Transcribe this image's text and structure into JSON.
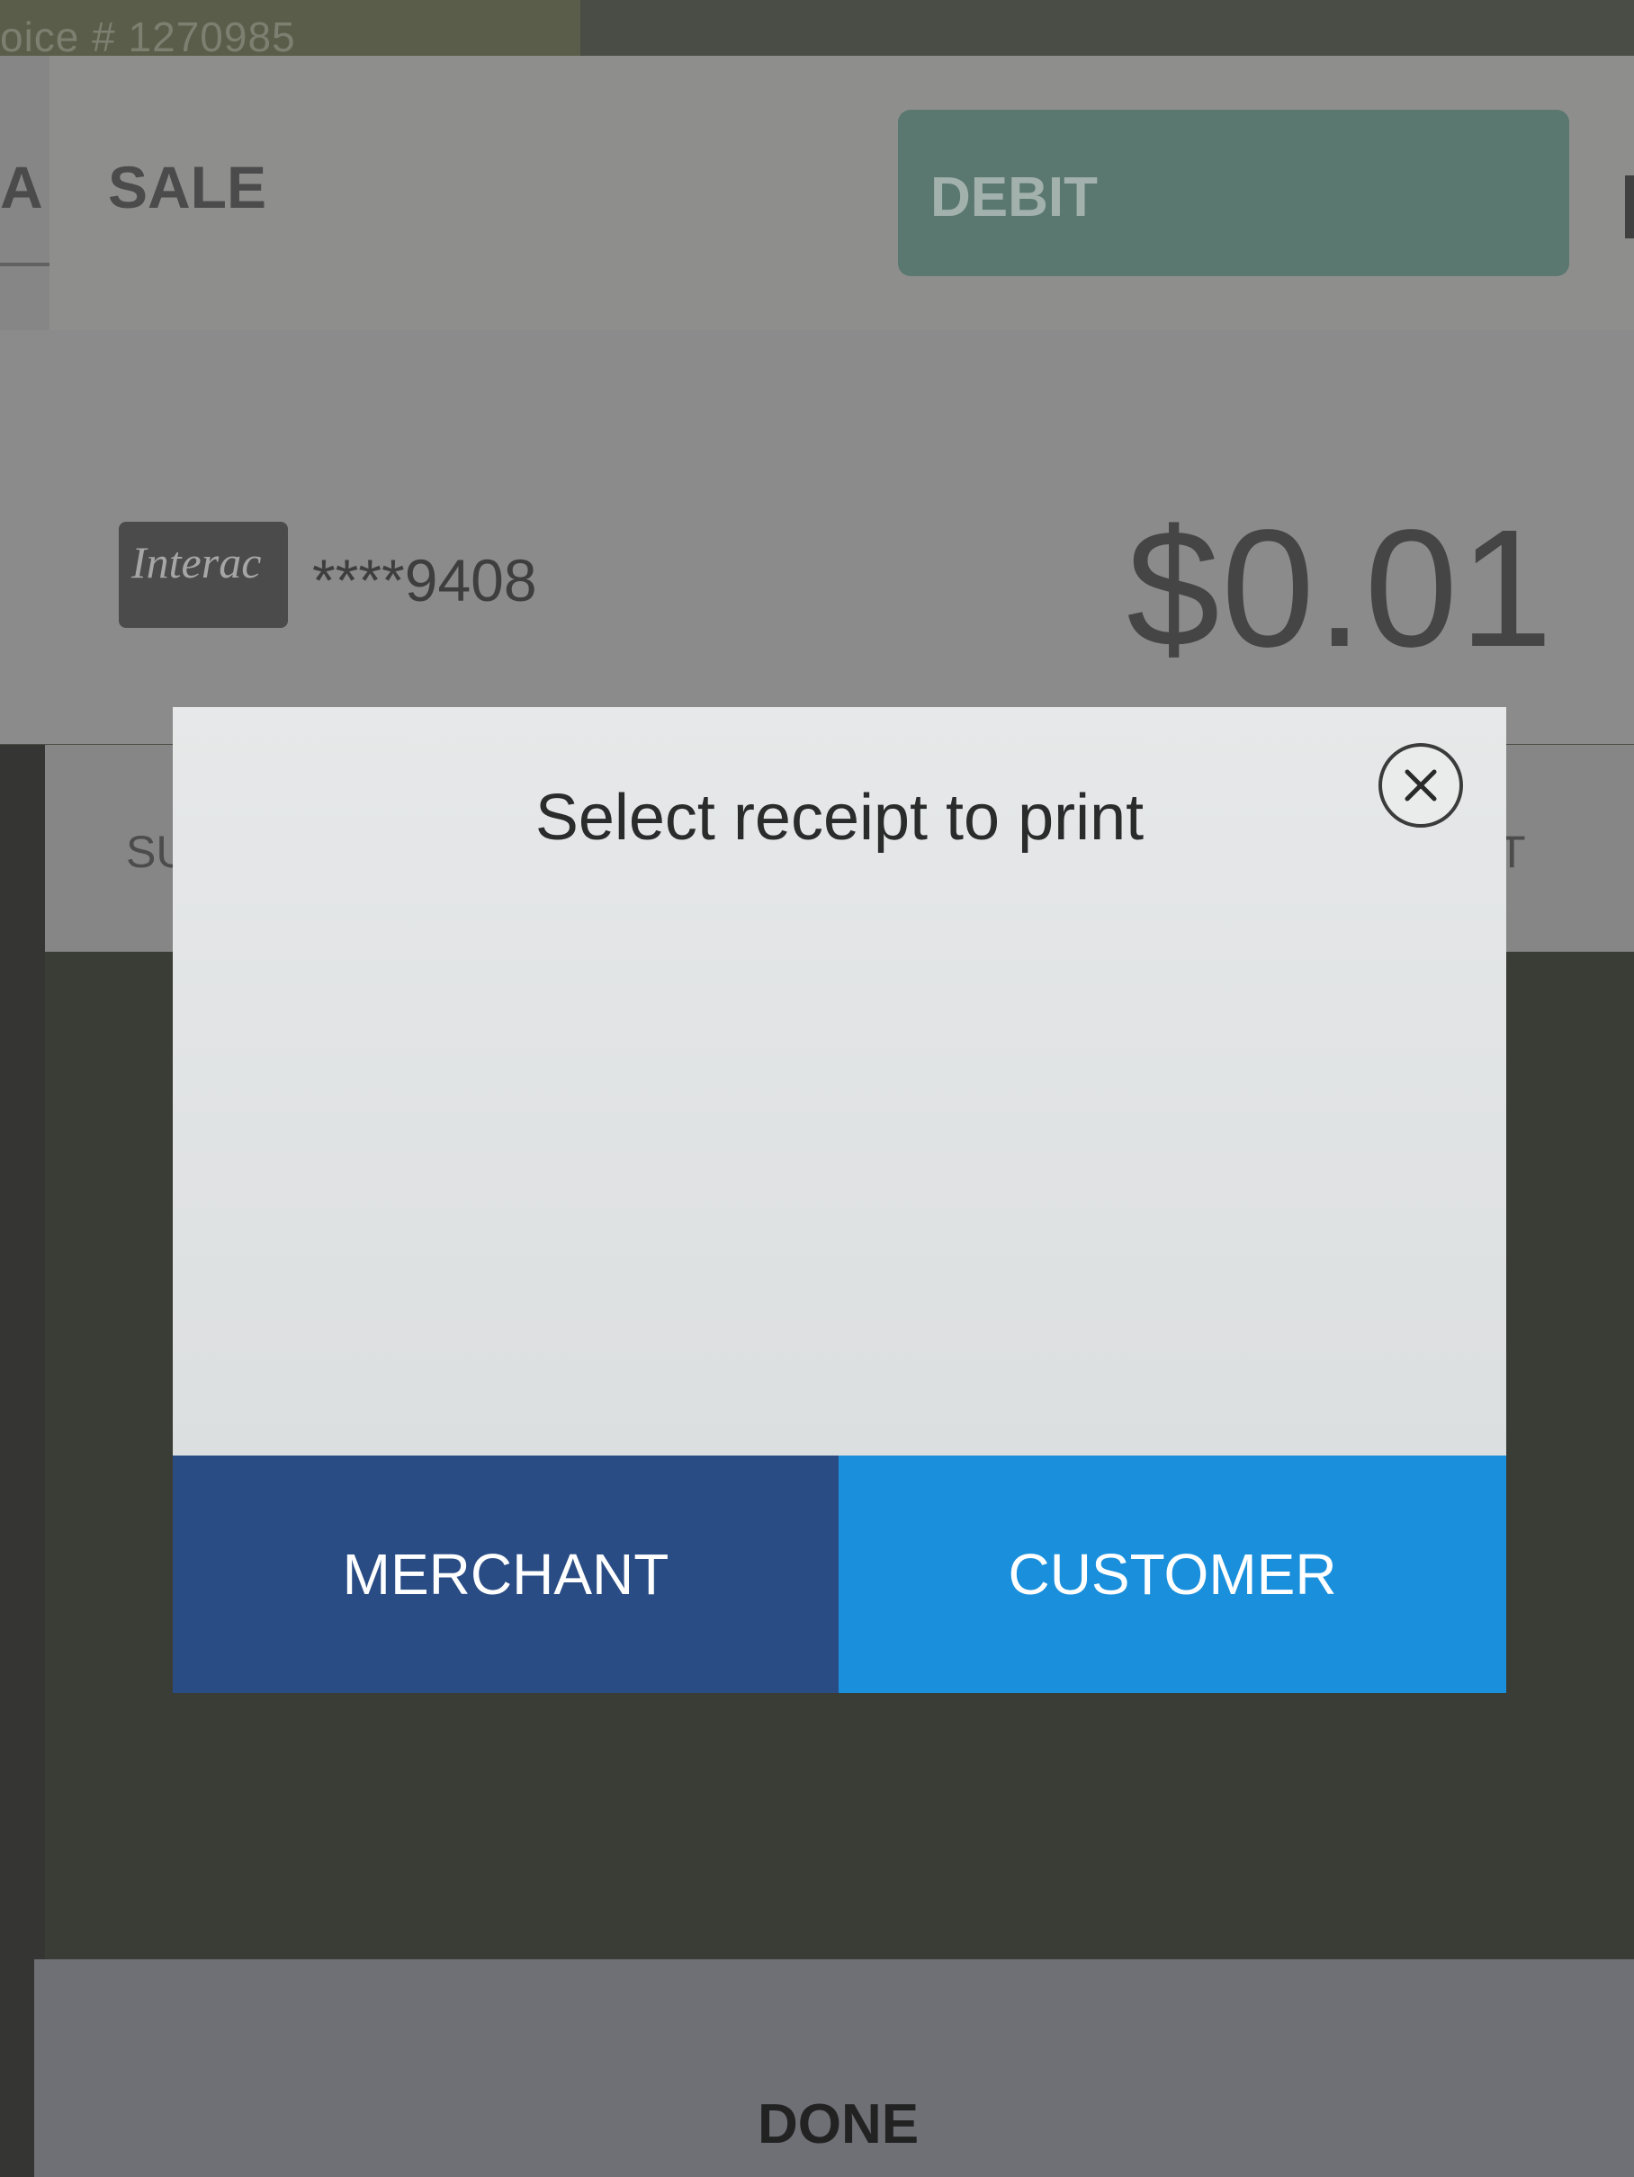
{
  "background": {
    "invoice_label": "oice # 1270985",
    "tab_prefix": "A",
    "tab_label": "SALE",
    "payment_type": "DEBIT",
    "card_brand": "Interac",
    "card_masked": "****9408",
    "amount": "$0.01",
    "summary_label": "SU",
    "summary_right": "T",
    "done_label": "DONE"
  },
  "modal": {
    "title": "Select receipt to print",
    "close_icon": "close-icon",
    "merchant_label": "MERCHANT",
    "customer_label": "CUSTOMER"
  },
  "colors": {
    "merchant_button": "#2a4c85",
    "customer_button": "#1a8fdc",
    "debit_tab": "#5a7770"
  }
}
